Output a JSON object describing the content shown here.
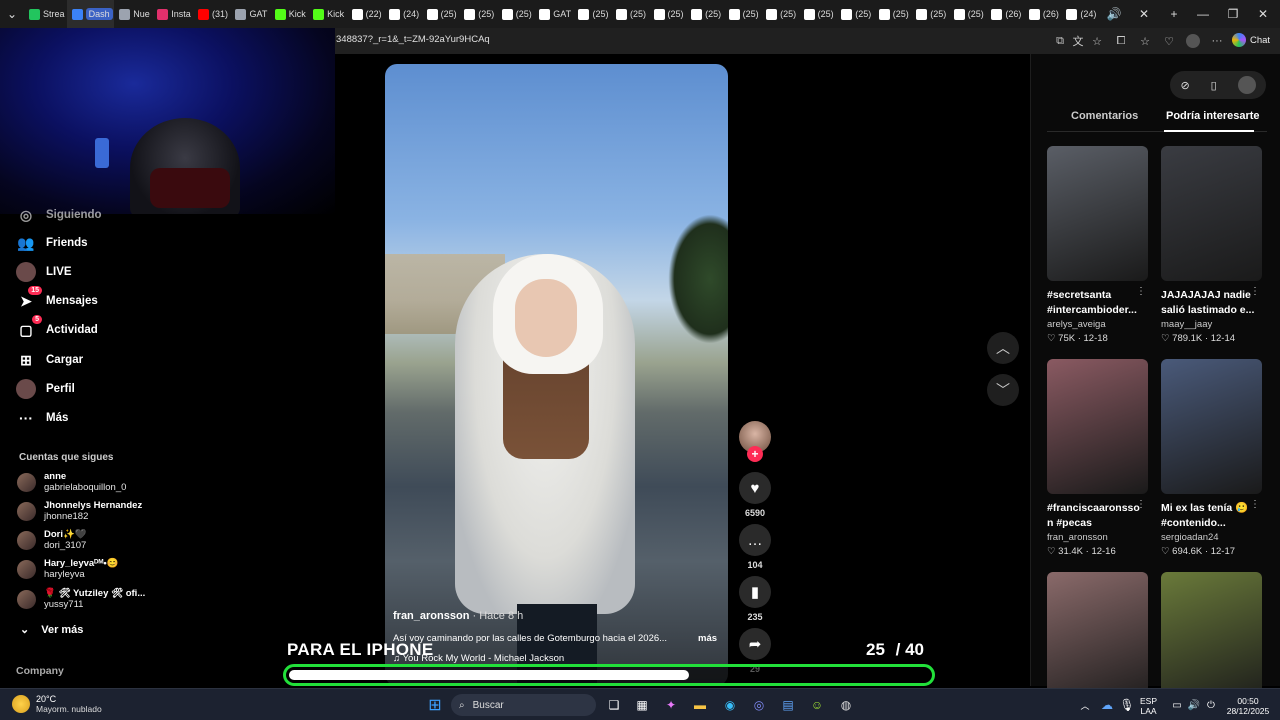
{
  "browser": {
    "tabs": [
      {
        "label": "Strea",
        "color": "#22c55e"
      },
      {
        "label": "Dash",
        "color": "#3b82f6",
        "active": true
      },
      {
        "label": "Nue",
        "color": "#9ca3af"
      },
      {
        "label": "Insta",
        "color": "#e1306c"
      },
      {
        "label": "(31)",
        "color": "#ff0000"
      },
      {
        "label": "GAT",
        "color": "#9ca3af"
      },
      {
        "label": "Kick",
        "color": "#53fc18"
      },
      {
        "label": "Kick",
        "color": "#53fc18"
      },
      {
        "label": "(22)",
        "color": "#fff"
      },
      {
        "label": "(24)",
        "color": "#fff"
      },
      {
        "label": "(25)",
        "color": "#fff"
      },
      {
        "label": "(25)",
        "color": "#fff"
      },
      {
        "label": "(25)",
        "color": "#fff"
      },
      {
        "label": "GAT",
        "color": "#fff"
      },
      {
        "label": "(25)",
        "color": "#fff"
      },
      {
        "label": "(25)",
        "color": "#fff"
      },
      {
        "label": "(25)",
        "color": "#fff"
      },
      {
        "label": "(25)",
        "color": "#fff"
      },
      {
        "label": "(25)",
        "color": "#fff"
      },
      {
        "label": "(25)",
        "color": "#fff"
      },
      {
        "label": "(25)",
        "color": "#fff"
      },
      {
        "label": "(25)",
        "color": "#fff"
      },
      {
        "label": "(25)",
        "color": "#fff"
      },
      {
        "label": "(25)",
        "color": "#fff"
      },
      {
        "label": "(25)",
        "color": "#fff"
      },
      {
        "label": "(26)",
        "color": "#fff"
      },
      {
        "label": "(26)",
        "color": "#fff"
      },
      {
        "label": "(24)",
        "color": "#fff"
      }
    ],
    "url": "348837?_r=1&_t=ZM-92aYur9HCAq",
    "chat_label": "Chat"
  },
  "nav": {
    "partial_label": "Siguiendo",
    "items": [
      {
        "label": "Friends",
        "icon": "friends-icon",
        "glyph": "👥"
      },
      {
        "label": "LIVE",
        "icon": "live-icon",
        "glyph": "●"
      },
      {
        "label": "Mensajes",
        "icon": "messages-icon",
        "glyph": "➤",
        "badge": "15"
      },
      {
        "label": "Actividad",
        "icon": "activity-icon",
        "glyph": "▢",
        "badge": "5"
      },
      {
        "label": "Cargar",
        "icon": "upload-icon",
        "glyph": "⊞"
      },
      {
        "label": "Perfil",
        "icon": "profile-icon",
        "glyph": "◉"
      },
      {
        "label": "Más",
        "icon": "more-icon",
        "glyph": "···"
      }
    ],
    "follows_heading": "Cuentas que sigues",
    "accounts": [
      {
        "name": "anne",
        "handle": "gabrielaboquillon_0"
      },
      {
        "name": "Jhonnelys Hernandez",
        "handle": "jhonne182"
      },
      {
        "name": "Dori✨🖤",
        "handle": "dori_3107"
      },
      {
        "name": "Hary_leyvaᴰᴹ•😊",
        "handle": "haryleyva"
      },
      {
        "name": "🌹 🛠 Yutzileу 🛠 ofi...",
        "handle": "yussy711"
      }
    ],
    "see_more": "Ver más",
    "company": "Company"
  },
  "video": {
    "author": "fran_aronsson",
    "time": "· Hace 8 h",
    "description": "Así voy caminando por las calles de Gotemburgo hacia el 2026...",
    "more": "más",
    "music": "♫ You Rock My World - Michael Jackson",
    "likes": "6590",
    "comments": "104",
    "saves": "235",
    "shares": "29"
  },
  "right_panel": {
    "tabs": [
      "Comentarios",
      "Podría interesarte"
    ],
    "cards": [
      {
        "caption": "#secretsanta #intercambioder...",
        "user": "arelys_aveiga",
        "likes": "♡ 75K",
        "date": "12-18",
        "thumb": "#5a5e66"
      },
      {
        "caption": "JAJAJAJAJ nadie salió lastimado e...",
        "user": "maay__jaay",
        "likes": "♡ 789.1K",
        "date": "12-14",
        "thumb": "#3a3c42"
      },
      {
        "caption": "#franciscaaronsso n #pecas",
        "user": "fran_aronsson",
        "likes": "♡ 31.4K",
        "date": "12-16",
        "thumb": "#8a5a62"
      },
      {
        "caption": "Mi ex las tenía 🥲 #contenido...",
        "user": "sergioadan24",
        "likes": "♡ 694.6K",
        "date": "12-17",
        "thumb": "#4a5a7a"
      },
      {
        "caption": "",
        "user": "",
        "likes": "",
        "date": "",
        "thumb": "#8a6a6a"
      },
      {
        "caption": "",
        "user": "",
        "likes": "",
        "date": "",
        "thumb": "#6a7a3a"
      }
    ]
  },
  "overlay": {
    "title": "PARA EL IPHONE",
    "count": "25",
    "total": "/ 40",
    "progress": 0.625
  },
  "taskbar": {
    "temp": "20°C",
    "weather": "Mayorm. nublado",
    "search": "Buscar",
    "lang": "ESP",
    "region": "LAA",
    "time": "00:50",
    "date": "28/12/2025"
  }
}
